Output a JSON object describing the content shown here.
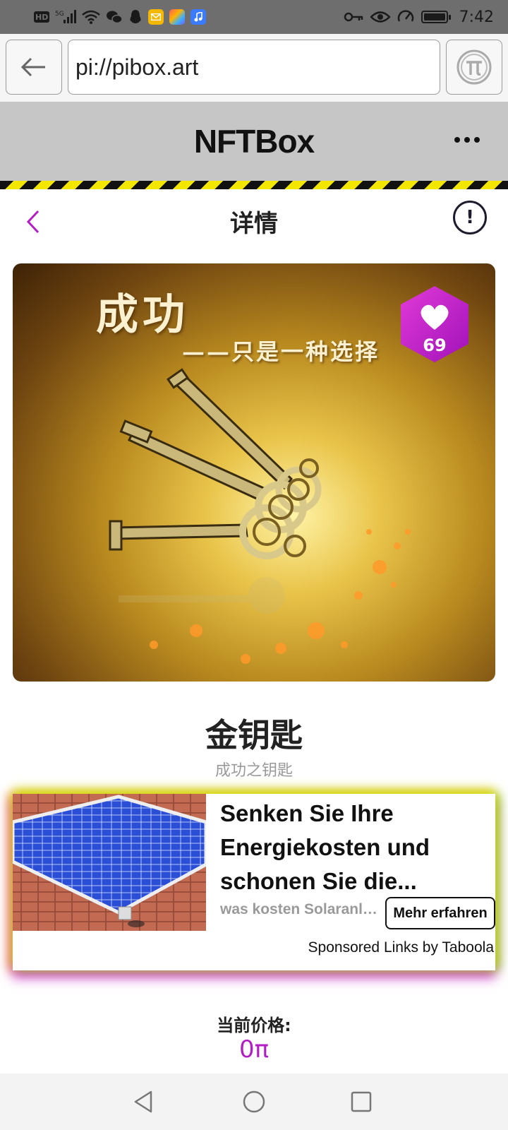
{
  "status_bar": {
    "left_icons": [
      "hd-icon",
      "signal-5g-icon",
      "wifi-icon",
      "wechat-icon",
      "qq-icon",
      "mail-app-icon",
      "gallery-app-icon",
      "music-app-icon"
    ],
    "hd_label": "HD",
    "net_label": "5G",
    "right_icons": [
      "key-icon",
      "eye-icon",
      "speed-icon",
      "battery-icon"
    ],
    "time": "7:42"
  },
  "browser": {
    "url": "pi://pibox.art"
  },
  "app": {
    "title": "NFTBox"
  },
  "page": {
    "title": "详情",
    "info_symbol": "!"
  },
  "nft": {
    "image_caption_1": "成功",
    "image_caption_2": "——只是一种选择",
    "likes": "69",
    "name": "金钥匙",
    "subtitle": "成功之钥匙"
  },
  "ad": {
    "headline": "Senken Sie Ihre Energiekosten und schonen Sie die...",
    "source": "was kosten Solaranlagen",
    "cta": "Mehr erfahren",
    "attribution": "Sponsored Links by Taboola"
  },
  "price": {
    "label": "当前价格:",
    "value": "0π"
  },
  "colors": {
    "accent": "#b21ec4",
    "header_bg": "#c6c6c6",
    "hazard_yellow": "#f3e600"
  }
}
